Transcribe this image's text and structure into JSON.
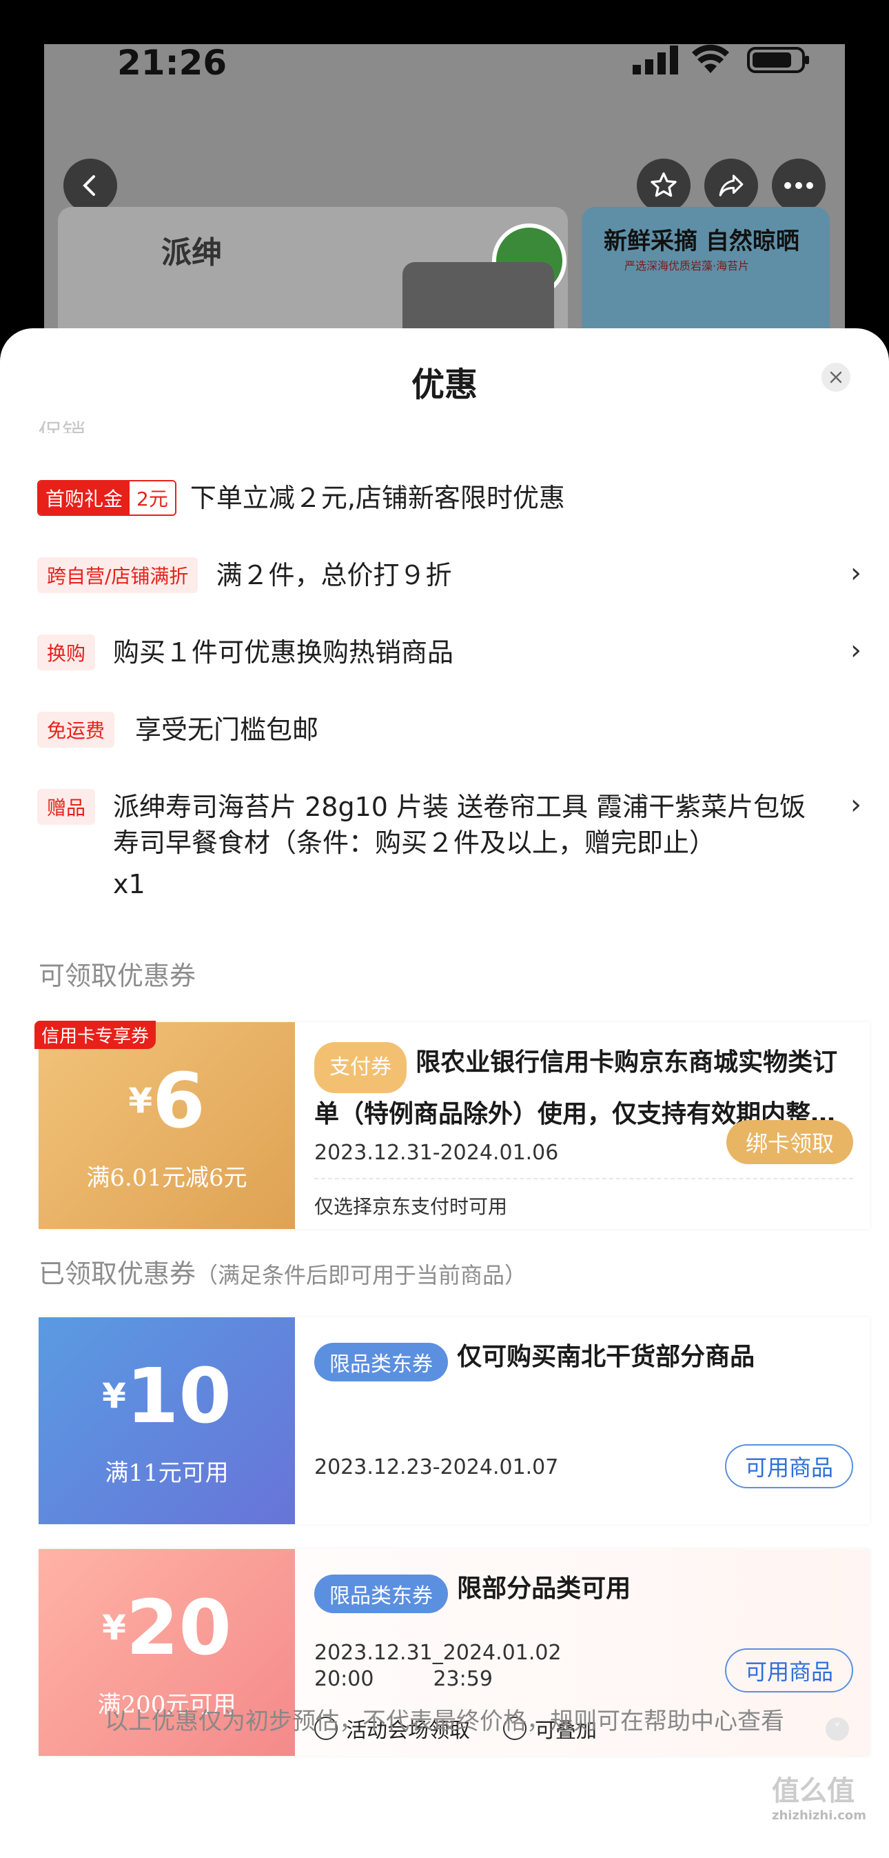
{
  "status_bar": {
    "time": "21:26"
  },
  "background": {
    "brand_logo": "派绅",
    "banner_headline": "新鲜采摘 自然晾晒",
    "banner_sub": "严选深海优质岩藻·海苔片"
  },
  "sheet": {
    "title": "优惠",
    "faded_label": "促销",
    "promotions": [
      {
        "tag_a": "首购礼金",
        "tag_b": "2元",
        "text": "下单立减２元,店铺新客限时优惠",
        "chevron": ""
      },
      {
        "tag": "跨自营/店铺满折",
        "text": "满２件，总价打９折",
        "chevron": "›"
      },
      {
        "tag": "换购",
        "text": "购买１件可优惠换购热销商品",
        "chevron": "›"
      },
      {
        "tag": "免运费",
        "text": "享受无门槛包邮",
        "chevron": ""
      },
      {
        "tag": "赠品",
        "text_line1": "派绅寿司海苔片 28g10 片装 送卷帘工具 霞浦干紫菜片包饭",
        "text_line2": "寿司早餐食材（条件：购买２件及以上，赠完即止）",
        "text_line3": "x1",
        "chevron": "›"
      }
    ],
    "claimable_label": "可领取优惠券",
    "claimable_coupon": {
      "corner_badge": "信用卡专享券",
      "currency": "¥",
      "amount": "6",
      "condition": "满6.01元减6元",
      "type_pill": "支付券",
      "title": "限农业银行信用卡购京东商城实物类订单（特例商品除外）使用，仅支持有效期内整…",
      "dates": "2023.12.31-2024.01.06",
      "action": "绑卡领取",
      "note": "仅选择京东支付时可用"
    },
    "claimed_label": "已领取优惠券",
    "claimed_sub": "（满足条件后即可用于当前商品）",
    "claimed_coupons": [
      {
        "currency": "¥",
        "amount": "10",
        "condition": "满11元可用",
        "type_pill": "限品类东券",
        "title": "仅可购买南北干货部分商品",
        "dates": "2023.12.23-2024.01.07",
        "action": "可用商品"
      },
      {
        "currency": "¥",
        "amount": "20",
        "condition": "满200元可用",
        "type_pill": "限品类东券",
        "title": "限部分品类可用",
        "date_start": "2023.12.31",
        "time_start": "20:00",
        "date_end": "2024.01.02",
        "time_end": "23:59",
        "action": "可用商品",
        "meta1": "活动会场领取",
        "meta2": "可叠加"
      }
    ],
    "footer": "以上优惠仅为初步预估，不代表最终价格，规则可在帮助中心查看",
    "watermark": "值么值",
    "watermark_url": "zhizhizhi.com"
  },
  "colors": {
    "accent_red": "#e8201a",
    "gold": "#e3ad57",
    "blue": "#5b8fe0",
    "pink": "#f78a8a"
  }
}
